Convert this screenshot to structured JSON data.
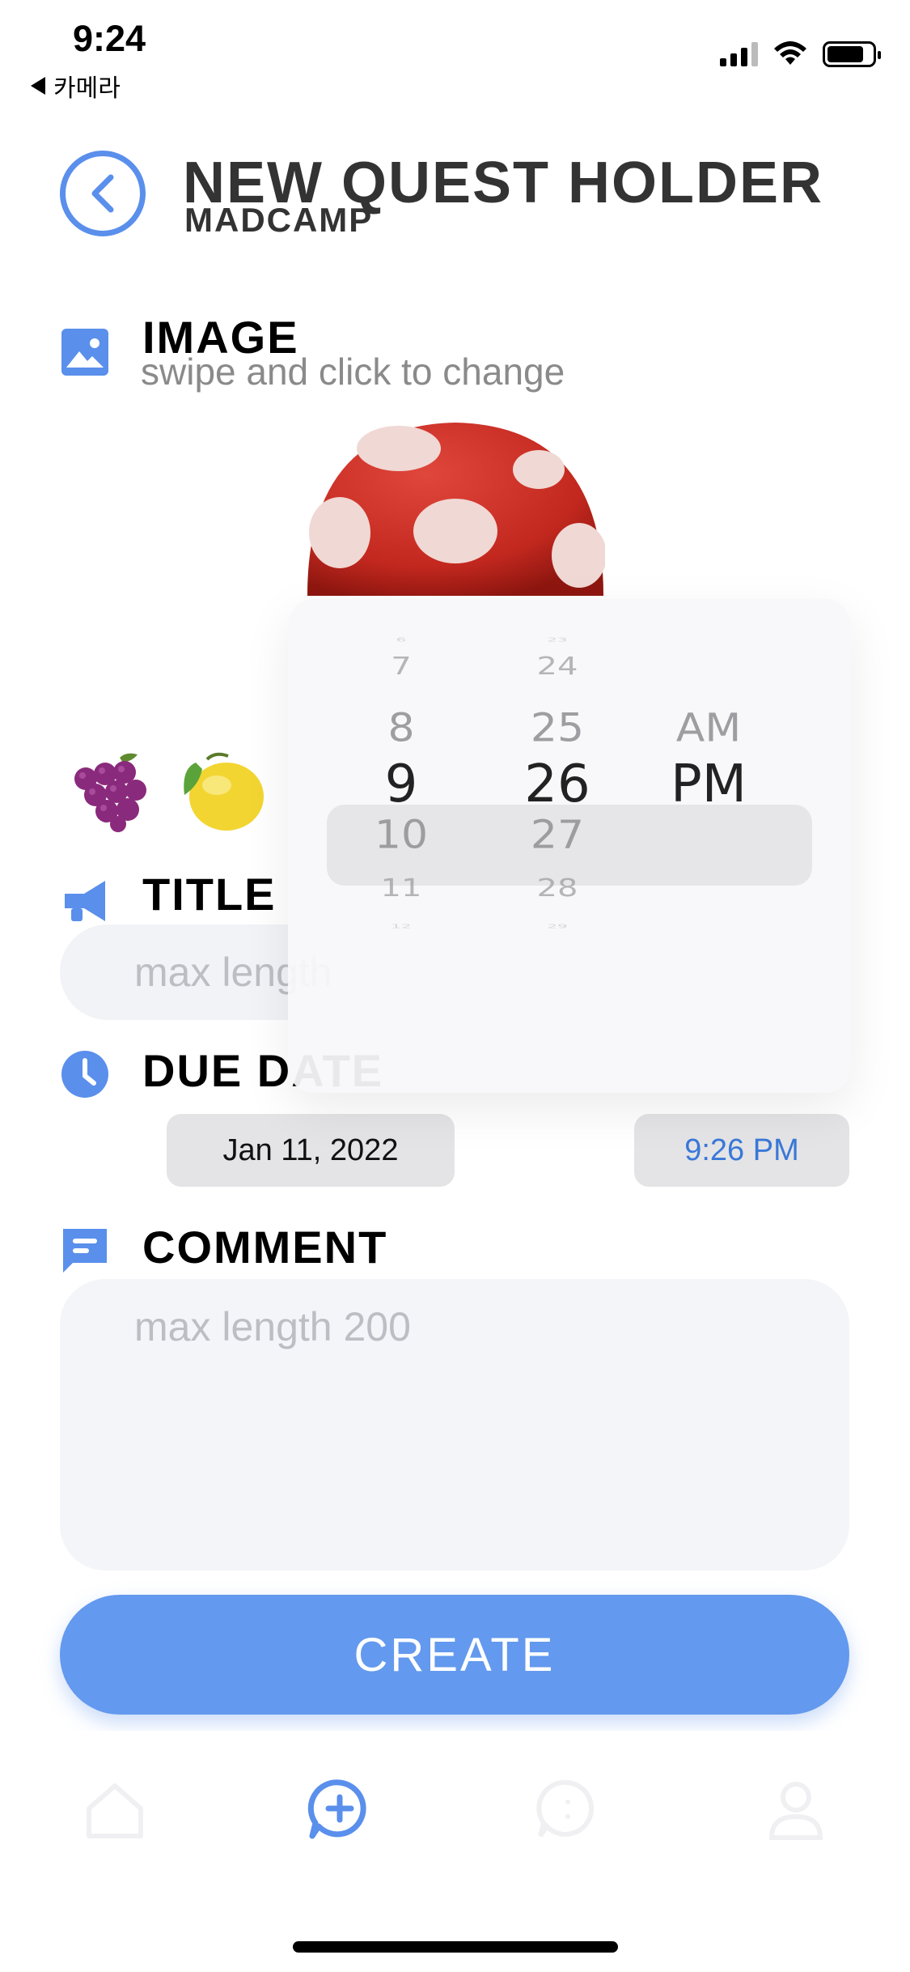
{
  "status_bar": {
    "time": "9:24",
    "back_app": "카메라"
  },
  "header": {
    "title": "NEW QUEST HOLDER",
    "subtitle": "MADCAMP"
  },
  "image_section": {
    "label": "IMAGE",
    "hint": "swipe and click to change",
    "selected_image": "mushroom",
    "other_images": [
      "grapes",
      "lemon"
    ]
  },
  "title_section": {
    "label": "TITLE",
    "placeholder": "max length"
  },
  "due_date_section": {
    "label": "DUE DATE",
    "date": "Jan 11, 2022",
    "time": "9:26 PM"
  },
  "comment_section": {
    "label": "COMMENT",
    "placeholder": "max length 200"
  },
  "create_button": {
    "label": "CREATE"
  },
  "time_picker": {
    "hours": [
      "6",
      "7",
      "8",
      "9",
      "10",
      "11",
      "12"
    ],
    "minutes": [
      "23",
      "24",
      "25",
      "26",
      "27",
      "28",
      "29"
    ],
    "ampm": [
      "AM",
      "PM"
    ],
    "selected": {
      "hour": "9",
      "minute": "26",
      "ampm": "PM"
    }
  },
  "tabbar": {
    "items": [
      "home-icon",
      "add-quest-icon",
      "chat-icon",
      "profile-icon"
    ],
    "active": "add-quest-icon"
  },
  "colors": {
    "accent": "#6399ee",
    "accent_dark": "#5a8fec",
    "text_dark": "#333333",
    "placeholder": "#bdbdc4"
  }
}
